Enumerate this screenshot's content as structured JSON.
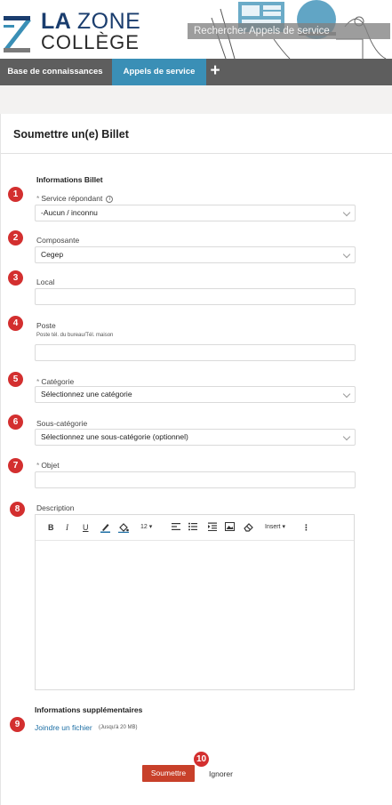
{
  "header": {
    "logo_la": "LA",
    "logo_zone": "ZONE",
    "logo_college": "COLLÈGE",
    "search_placeholder": "Rechercher Appels de service"
  },
  "nav": {
    "tabs": [
      {
        "label": "Base de connaissances",
        "active": false
      },
      {
        "label": "Appels de service",
        "active": true
      }
    ],
    "add_label": "+"
  },
  "form": {
    "title": "Soumettre un(e) Billet",
    "section_info": "Informations Billet",
    "fields": {
      "service": {
        "label": "Service répondant",
        "required": true,
        "value": "-Aucun     / inconnu",
        "badge": "1"
      },
      "composante": {
        "label": "Composante",
        "value": "Cegep",
        "badge": "2"
      },
      "local": {
        "label": "Local",
        "value": "",
        "badge": "3"
      },
      "poste": {
        "label": "Poste",
        "hint": "Poste tél. du bureau/Tél. maison",
        "value": "",
        "badge": "4"
      },
      "categorie": {
        "label": "Catégorie",
        "required": true,
        "value": "Sélectionnez une catégorie",
        "badge": "5"
      },
      "sous_categorie": {
        "label": "Sous-catégorie",
        "value": "Sélectionnez une sous-catégorie (optionnel)",
        "badge": "6"
      },
      "objet": {
        "label": "Objet",
        "required": true,
        "value": "",
        "badge": "7"
      },
      "description": {
        "label": "Description",
        "value": "",
        "badge": "8"
      }
    },
    "editor_toolbar": {
      "bold": "B",
      "italic": "I",
      "underline": "U",
      "font_size": "12",
      "insert": "Insert"
    },
    "section_extra": "Informations supplémentaires",
    "attach_link": "Joindre un fichier",
    "attach_hint": "(Jusqu'à 20 MB)",
    "attach_badge": "9",
    "submit_label": "Soumettre",
    "submit_badge": "10",
    "ignore_label": "Ignorer"
  },
  "colors": {
    "nav_bg": "#5e5e5e",
    "nav_active": "#3a8fb6",
    "badge": "#d32f2f",
    "submit": "#c8402a",
    "link": "#1d6fa5",
    "logo_blue": "#1a3d6e"
  }
}
